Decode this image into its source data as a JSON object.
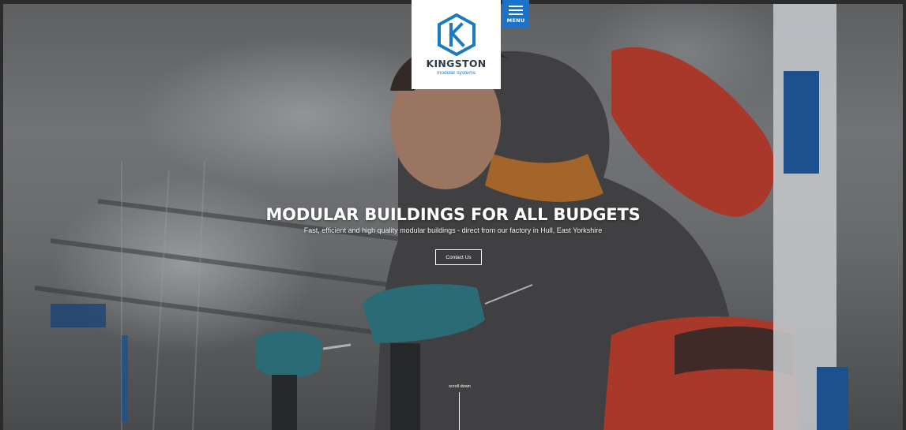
{
  "brand": {
    "name": "KINGSTON",
    "tagline": "modular systems",
    "colors": {
      "primary_blue": "#1a7bc1",
      "dark_text": "#2d3a4a"
    }
  },
  "menu": {
    "label": "MENU",
    "icon": "hamburger-icon"
  },
  "hero": {
    "title": "MODULAR BUILDINGS FOR ALL BUDGETS",
    "subtitle": "Fast, efficient and high quality modular buildings - direct from our factory in Hull, East Yorkshire",
    "cta_label": "Contact Us"
  },
  "scroll": {
    "label": "scroll down"
  }
}
